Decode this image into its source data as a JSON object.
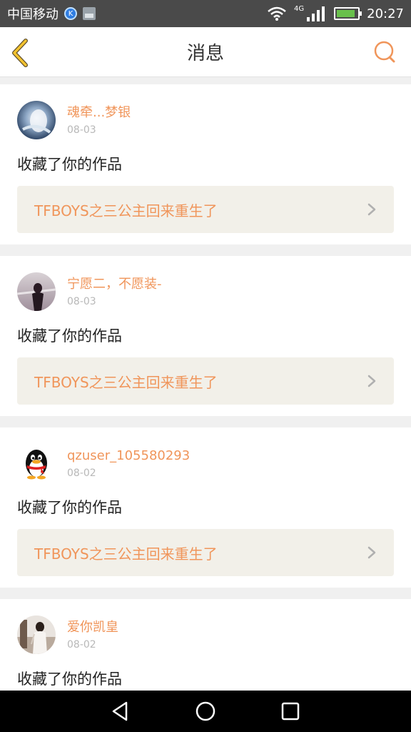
{
  "status_bar": {
    "carrier": "中国移动",
    "network": "4G",
    "time": "20:27",
    "battery_level": 0.9
  },
  "nav": {
    "title": "消息",
    "accent": "#f0955a"
  },
  "messages": [
    {
      "user_name": "魂牵...梦银",
      "date": "08-03",
      "action_text": "收藏了你的作品",
      "work_title": "TFBOYS之三公主回来重生了"
    },
    {
      "user_name": "宁愿二，不愿装-",
      "date": "08-03",
      "action_text": "收藏了你的作品",
      "work_title": "TFBOYS之三公主回来重生了"
    },
    {
      "user_name": "qzuser_105580293",
      "date": "08-02",
      "action_text": "收藏了你的作品",
      "work_title": "TFBOYS之三公主回来重生了"
    },
    {
      "user_name": "爱你凯皇",
      "date": "08-02",
      "action_text": "收藏了你的作品",
      "work_title": ""
    }
  ],
  "icons": {
    "back": "chevron-left-icon",
    "search": "search-icon",
    "avatar_qq": "qq-penguin-icon"
  }
}
